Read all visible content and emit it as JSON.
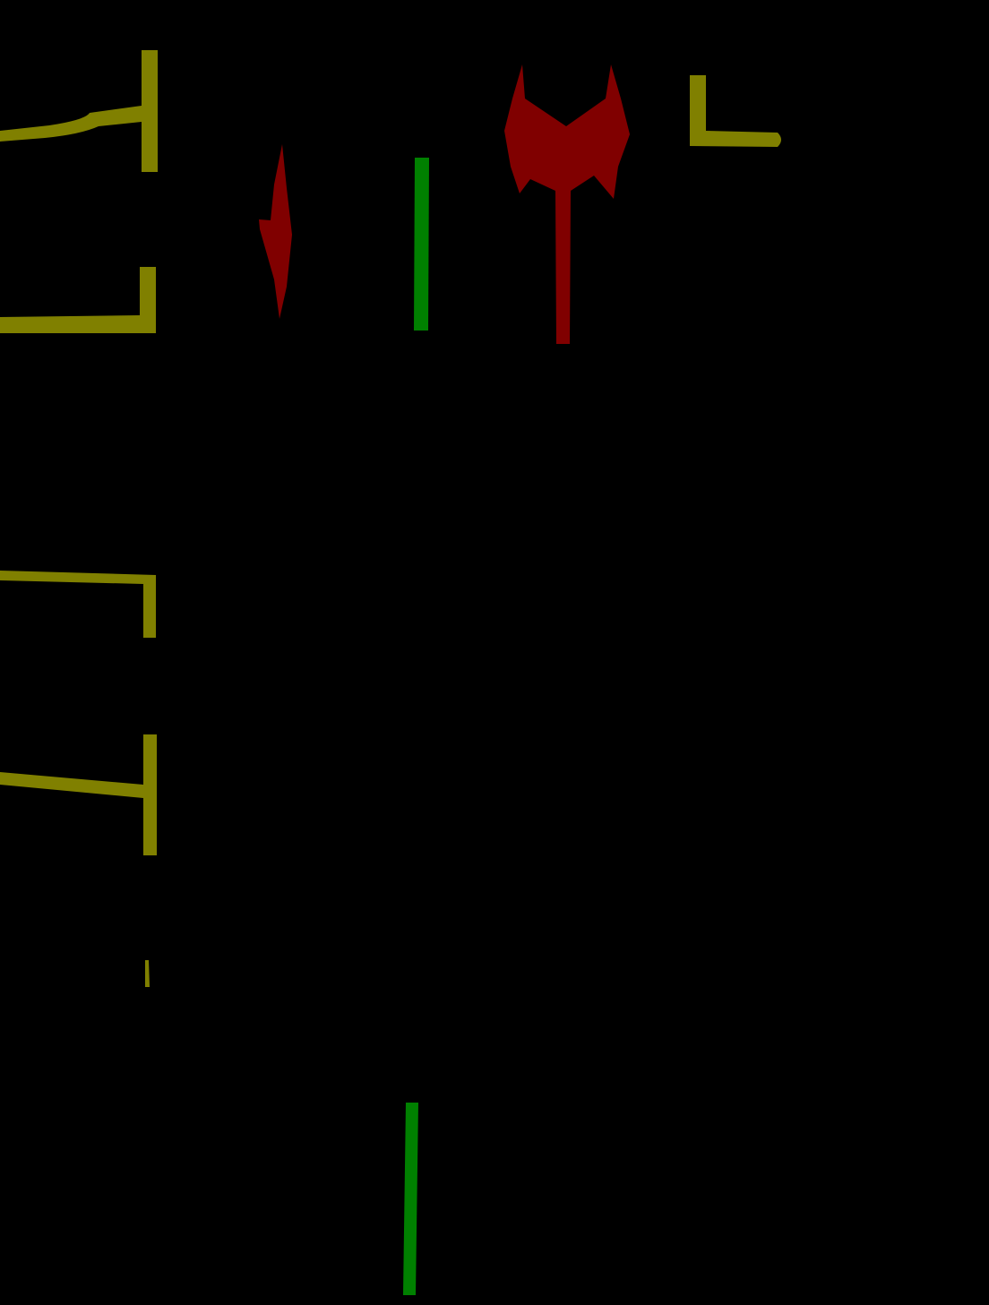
{
  "background_color": "#000000",
  "palette": {
    "boundary": "#808000",
    "divider": "#008000",
    "arrow": "#800000"
  },
  "regions": [
    {
      "name": "upper-t-junction-marking",
      "color_key": "boundary"
    },
    {
      "name": "upper-l-corner-marking",
      "color_key": "boundary"
    },
    {
      "name": "top-right-l-marking",
      "color_key": "boundary"
    },
    {
      "name": "middle-bracket-marking",
      "color_key": "boundary"
    },
    {
      "name": "lower-t-junction-marking",
      "color_key": "boundary"
    },
    {
      "name": "small-fragment-marking",
      "color_key": "boundary"
    },
    {
      "name": "upper-lane-divider",
      "color_key": "divider"
    },
    {
      "name": "lower-lane-divider",
      "color_key": "divider"
    },
    {
      "name": "straight-arrow-marking",
      "color_key": "arrow"
    },
    {
      "name": "turn-arrow-marking",
      "color_key": "arrow"
    }
  ]
}
